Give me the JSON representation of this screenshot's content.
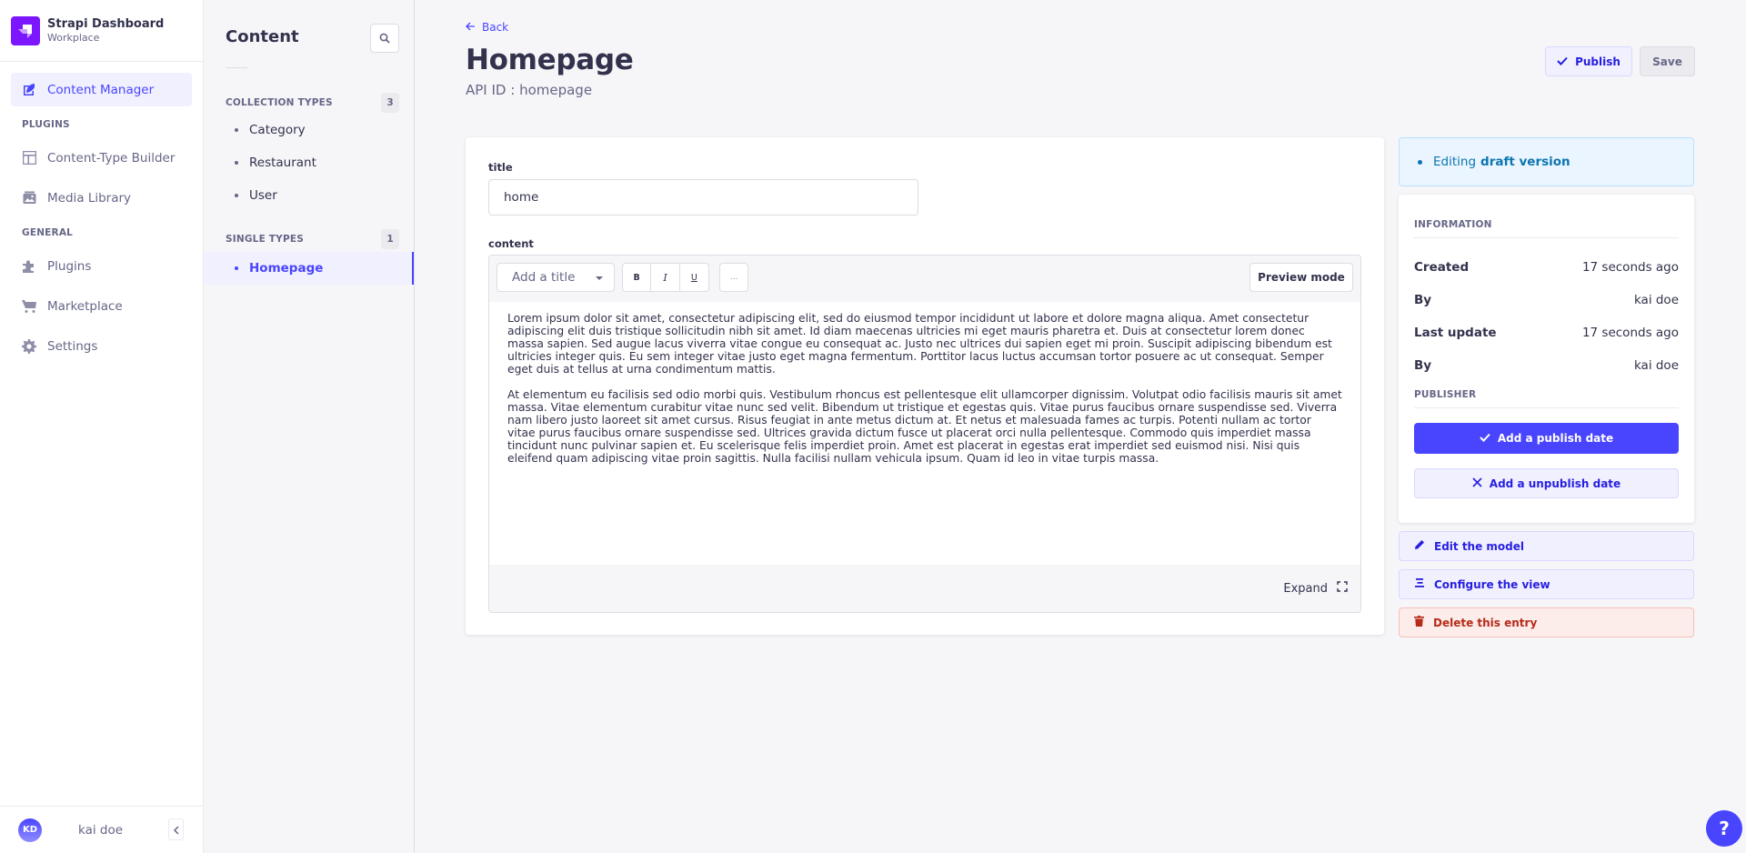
{
  "brand": {
    "name": "Strapi Dashboard",
    "workspace": "Workplace",
    "logo_color": "#7b16ff"
  },
  "mainnav": {
    "content_manager": {
      "label": "Content Manager",
      "icon": "feather-icon",
      "active": true
    },
    "sections": [
      {
        "label": "PLUGINS",
        "items": [
          {
            "label": "Content-Type Builder",
            "icon": "layout-icon"
          },
          {
            "label": "Media Library",
            "icon": "image-icon"
          }
        ]
      },
      {
        "label": "GENERAL",
        "items": [
          {
            "label": "Plugins",
            "icon": "puzzle-icon"
          },
          {
            "label": "Marketplace",
            "icon": "cart-icon"
          },
          {
            "label": "Settings",
            "icon": "gear-icon"
          }
        ]
      }
    ],
    "user": {
      "initials": "KD",
      "name": "kai doe"
    }
  },
  "subnav": {
    "title": "Content",
    "collection_types": {
      "label": "COLLECTION TYPES",
      "count": "3",
      "items": [
        "Category",
        "Restaurant",
        "User"
      ]
    },
    "single_types": {
      "label": "SINGLE TYPES",
      "count": "1",
      "items": [
        "Homepage"
      ],
      "active": "Homepage"
    }
  },
  "header": {
    "back_label": "Back",
    "title": "Homepage",
    "api_id": "API ID : homepage",
    "publish_label": "Publish",
    "save_label": "Save"
  },
  "form": {
    "title_label": "title",
    "title_value": "home",
    "content_label": "content",
    "editor": {
      "heading_placeholder": "Add a title",
      "bold": "B",
      "italic": "I",
      "underline": "U",
      "more": "...",
      "preview_label": "Preview mode",
      "expand_label": "Expand",
      "paragraphs": [
        "Lorem ipsum dolor sit amet, consectetur adipiscing elit, sed do eiusmod tempor incididunt ut labore et dolore magna aliqua. Amet consectetur adipiscing elit duis tristique sollicitudin nibh sit amet. Id diam maecenas ultricies mi eget mauris pharetra et. Duis at consectetur lorem donec massa sapien. Sed augue lacus viverra vitae congue eu consequat ac. Justo nec ultrices dui sapien eget mi proin. Suscipit adipiscing bibendum est ultricies integer quis. Eu sem integer vitae justo eget magna fermentum. Porttitor lacus luctus accumsan tortor posuere ac ut consequat. Semper eget duis at tellus at urna condimentum mattis.",
        "At elementum eu facilisis sed odio morbi quis. Vestibulum rhoncus est pellentesque elit ullamcorper dignissim. Volutpat odio facilisis mauris sit amet massa. Vitae elementum curabitur vitae nunc sed velit. Bibendum ut tristique et egestas quis. Vitae purus faucibus ornare suspendisse sed. Viverra nam libero justo laoreet sit amet cursus. Risus feugiat in ante metus dictum at. Et netus et malesuada fames ac turpis. Potenti nullam ac tortor vitae purus faucibus ornare suspendisse sed. Ultrices gravida dictum fusce ut placerat orci nulla pellentesque. Commodo quis imperdiet massa tincidunt nunc pulvinar sapien et. Eu scelerisque felis imperdiet proin. Amet est placerat in egestas erat imperdiet sed euismod nisi. Nisi quis eleifend quam adipiscing vitae proin sagittis. Nulla facilisi nullam vehicula ipsum. Quam id leo in vitae turpis massa."
      ]
    }
  },
  "sidepanel": {
    "draft_prefix": "Editing",
    "draft_strong": "draft version",
    "information_label": "INFORMATION",
    "info": [
      {
        "key": "Created",
        "value": "17 seconds ago"
      },
      {
        "key": "By",
        "value": "kai doe"
      },
      {
        "key": "Last update",
        "value": "17 seconds ago"
      },
      {
        "key": "By",
        "value": "kai doe"
      }
    ],
    "publisher_label": "PUBLISHER",
    "add_publish_date": "Add a publish date",
    "add_unpublish_date": "Add a unpublish date",
    "edit_model": "Edit the model",
    "configure_view": "Configure the view",
    "delete_entry": "Delete this entry"
  },
  "help_label": "?",
  "colors": {
    "primary": "#4945ff",
    "primary_light": "#f0f0ff",
    "danger": "#b72b1a",
    "info": "#0c75af"
  }
}
